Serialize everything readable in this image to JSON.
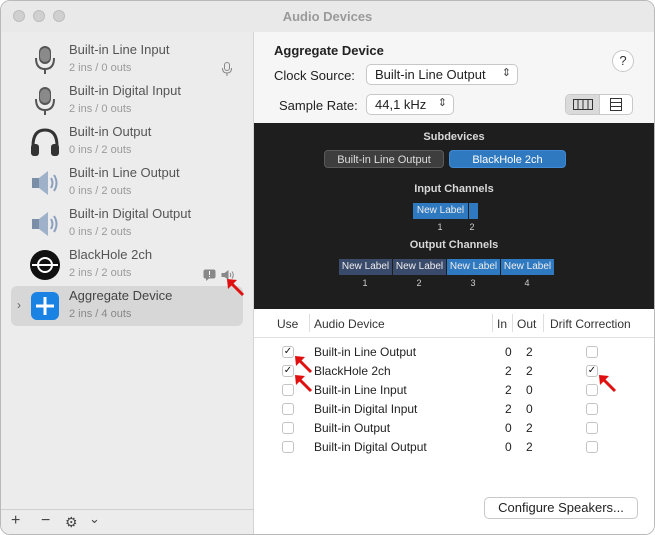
{
  "window": {
    "title": "Audio Devices"
  },
  "sidebar": {
    "devices": [
      {
        "name": "Built-in Line Input",
        "io": "2 ins / 0 outs",
        "icon": "microphone-icon"
      },
      {
        "name": "Built-in Digital Input",
        "io": "2 ins / 0 outs",
        "icon": "microphone-icon"
      },
      {
        "name": "Built-in Output",
        "io": "0 ins / 2 outs",
        "icon": "headphones-icon"
      },
      {
        "name": "Built-in Line Output",
        "io": "0 ins / 2 outs",
        "icon": "speaker-icon"
      },
      {
        "name": "Built-in Digital Output",
        "io": "0 ins / 2 outs",
        "icon": "speaker-icon"
      },
      {
        "name": "BlackHole 2ch",
        "io": "2 ins / 2 outs",
        "icon": "blackhole-icon"
      },
      {
        "name": "Aggregate Device",
        "io": "2 ins / 4 outs",
        "icon": "plus-icon"
      }
    ],
    "footer": {
      "add": "+",
      "remove": "−",
      "gear": "⚙",
      "menu": "⌄"
    }
  },
  "detail": {
    "title": "Aggregate Device",
    "clock_source_label": "Clock Source:",
    "clock_source_value": "Built-in Line Output",
    "sample_rate_label": "Sample Rate:",
    "sample_rate_value": "44,1 kHz",
    "help": "?"
  },
  "panel": {
    "subdevices_heading": "Subdevices",
    "subdevices": [
      "Built-in Line Output",
      "BlackHole 2ch"
    ],
    "input_heading": "Input Channels",
    "input_channels": [
      {
        "label": "New Label",
        "num": "1"
      },
      {
        "label": "",
        "num": "2"
      }
    ],
    "output_heading": "Output Channels",
    "output_channels": [
      {
        "label": "New Label",
        "num": "1"
      },
      {
        "label": "New Label",
        "num": "2"
      },
      {
        "label": "New Label",
        "num": "3"
      },
      {
        "label": "New Label",
        "num": "4"
      }
    ]
  },
  "table": {
    "headers": {
      "use": "Use",
      "device": "Audio Device",
      "in": "In",
      "out": "Out",
      "drift": "Drift Correction"
    },
    "rows": [
      {
        "use": true,
        "device": "Built-in Line Output",
        "in": "0",
        "out": "2",
        "drift": false
      },
      {
        "use": true,
        "device": "BlackHole 2ch",
        "in": "2",
        "out": "2",
        "drift": true
      },
      {
        "use": false,
        "device": "Built-in Line Input",
        "in": "2",
        "out": "0",
        "drift": false
      },
      {
        "use": false,
        "device": "Built-in Digital Input",
        "in": "2",
        "out": "0",
        "drift": false
      },
      {
        "use": false,
        "device": "Built-in Output",
        "in": "0",
        "out": "2",
        "drift": false
      },
      {
        "use": false,
        "device": "Built-in Digital Output",
        "in": "0",
        "out": "2",
        "drift": false
      }
    ]
  },
  "configure_button": "Configure Speakers...",
  "colors": {
    "accent": "#1a82e2",
    "channel_blue": "#2f79c0",
    "channel_dark": "#3a4a6a",
    "annotation": "#e01010"
  }
}
